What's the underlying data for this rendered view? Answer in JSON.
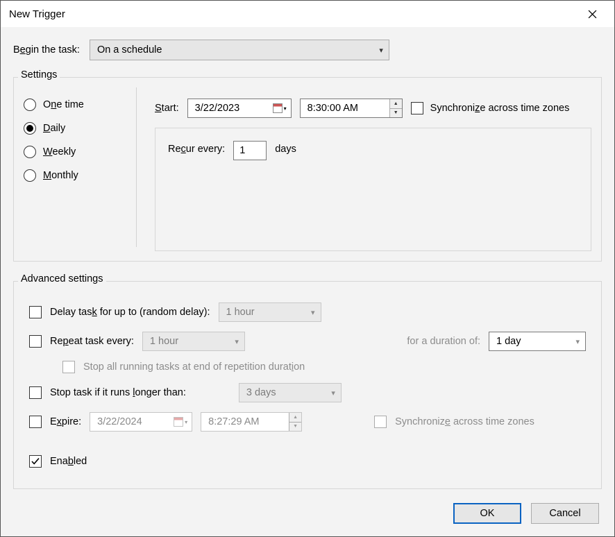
{
  "window": {
    "title": "New Trigger"
  },
  "begin": {
    "label": "Begin the task:",
    "value": "On a schedule"
  },
  "settings": {
    "legend": "Settings",
    "options": {
      "one_time": "One time",
      "daily": "Daily",
      "weekly": "Weekly",
      "monthly": "Monthly"
    },
    "selected": "daily",
    "start_label": "Start:",
    "start_date": "3/22/2023",
    "start_time": "8:30:00 AM",
    "sync_tz_label": "Synchronize across time zones",
    "recur_label": "Recur every:",
    "recur_value": "1",
    "recur_unit": "days"
  },
  "advanced": {
    "legend": "Advanced settings",
    "delay_label": "Delay task for up to (random delay):",
    "delay_value": "1 hour",
    "repeat_label": "Repeat task every:",
    "repeat_value": "1 hour",
    "duration_label": "for a duration of:",
    "duration_value": "1 day",
    "stop_rep_label": "Stop all running tasks at end of repetition duration",
    "stop_long_label": "Stop task if it runs longer than:",
    "stop_long_value": "3 days",
    "expire_label": "Expire:",
    "expire_date": "3/22/2024",
    "expire_time": "8:27:29 AM",
    "expire_sync_label": "Synchronize across time zones",
    "enabled_label": "Enabled"
  },
  "buttons": {
    "ok": "OK",
    "cancel": "Cancel"
  }
}
